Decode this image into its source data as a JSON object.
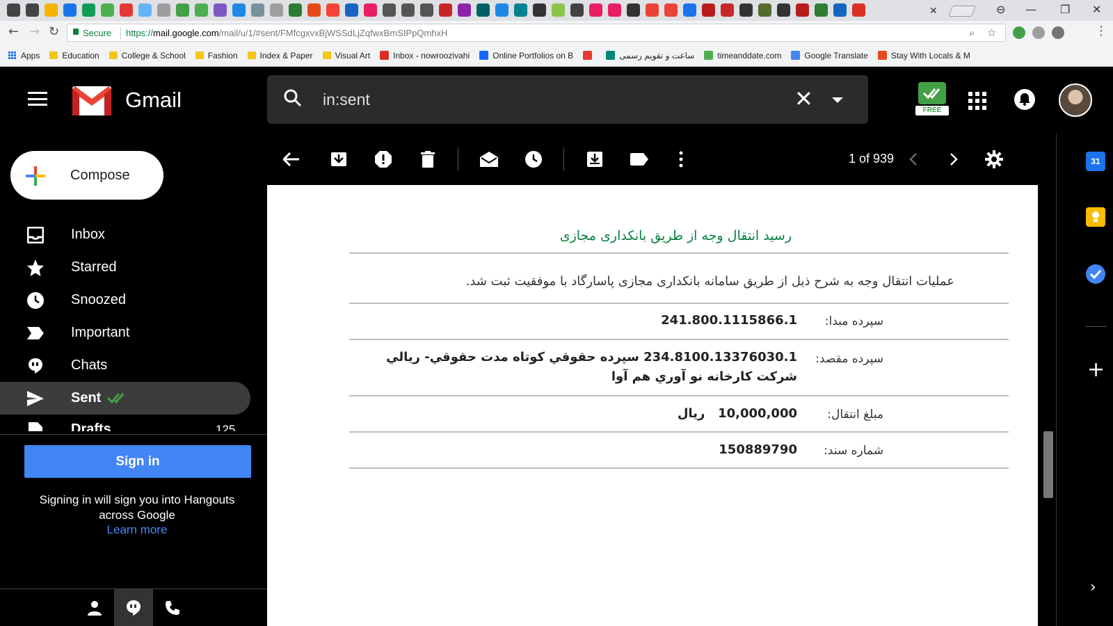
{
  "browser": {
    "tab_icon_colors": [
      "#444",
      "#444",
      "#f4b400",
      "#1a73e8",
      "#0f9d58",
      "#4caf50",
      "#e53935",
      "#64b5f6",
      "#9e9e9e",
      "#43a047",
      "#4caf50",
      "#7e57c2",
      "#1e88e5",
      "#78909c",
      "#9e9e9e",
      "#2e7d32",
      "#e64a19",
      "#f44336",
      "#1565c0",
      "#e91e63",
      "#555",
      "#555",
      "#555",
      "#c62828",
      "#8e24aa",
      "#006064",
      "#1e88e5",
      "#00838f",
      "#333",
      "#8bc34a",
      "#424242",
      "#e91e63",
      "#e91e63",
      "#333",
      "#ea4335",
      "#ea4335",
      "#1a73e8",
      "#b71c1c",
      "#c62828",
      "#333",
      "#556b2f",
      "#333",
      "#b71c1c",
      "#2e7d32",
      "#1565c0",
      "#d93025"
    ],
    "address": {
      "secure_label": "Secure",
      "url_scheme": "https://",
      "url_host": "mail.google.com",
      "url_path": "/mail/u/1/#sent/FMfcgxvxBjWSSdLjZqfwxBmSIPpQmhxH"
    },
    "bookmarks": [
      {
        "label": "Apps",
        "icon": "apps-grid-icon"
      },
      {
        "label": "Education",
        "icon": "folder-icon"
      },
      {
        "label": "College & School",
        "icon": "folder-icon"
      },
      {
        "label": "Fashion",
        "icon": "folder-icon"
      },
      {
        "label": "Index & Paper",
        "icon": "folder-icon"
      },
      {
        "label": "Visual Art",
        "icon": "folder-icon"
      },
      {
        "label": "Inbox - nowroozivahi",
        "icon": "gmail-icon",
        "color": "#d93025"
      },
      {
        "label": "Online Portfolios on B",
        "icon": "behance-icon",
        "color": "#1769ff"
      },
      {
        "label": "",
        "icon": "torob-icon",
        "color": "#e53935"
      },
      {
        "label": "ساعت و تقویم رسمی",
        "icon": "clock-icon",
        "color": "#00897b"
      },
      {
        "label": "timeanddate.com",
        "icon": "timeanddate-icon",
        "color": "#4caf50"
      },
      {
        "label": "Google Translate",
        "icon": "translate-icon",
        "color": "#4285f4"
      },
      {
        "label": "Stay With Locals & M",
        "icon": "couchsurfing-icon",
        "color": "#e64a19"
      }
    ]
  },
  "gmail": {
    "app_name": "Gmail",
    "search_query": "in:sent",
    "free_badge": "FREE",
    "compose_label": "Compose",
    "nav": [
      {
        "label": "Inbox",
        "icon": "inbox-icon",
        "count": "",
        "active": false
      },
      {
        "label": "Starred",
        "icon": "star-icon",
        "count": "",
        "active": false
      },
      {
        "label": "Snoozed",
        "icon": "clock-icon",
        "count": "",
        "active": false
      },
      {
        "label": "Important",
        "icon": "important-icon",
        "count": "",
        "active": false
      },
      {
        "label": "Chats",
        "icon": "chat-icon",
        "count": "",
        "active": false
      },
      {
        "label": "Sent",
        "icon": "send-icon",
        "count": "",
        "active": true
      },
      {
        "label": "Drafts",
        "icon": "draft-icon",
        "count": "125",
        "active": false
      }
    ],
    "hangouts": {
      "signin_label": "Sign in",
      "signin_note": "Signing in will sign you into Hangouts across Google",
      "learn_more": "Learn more"
    },
    "pager": "1 of 939"
  },
  "email": {
    "title": "رسید انتقال وجه از طریق بانکداری مجازی",
    "description": "عملیات انتقال وجه به شرح ذیل از طریق سامانه بانکداری مجازی پاسارگاد با موفقیت ثبت شد.",
    "rows": [
      {
        "label": "سپرده مبدا:",
        "value": "241.800.1115866.1",
        "value2": ""
      },
      {
        "label": "سپرده مقصد:",
        "value": "234.8100.13376030.1 سپرده حقوقي كوتاه مدت حقوقي- ريالي",
        "value2": "شركت كارخانه نو آوري هم آوا"
      },
      {
        "label": "مبلغ انتقال:",
        "value": "10,000,000   ريال",
        "value2": ""
      },
      {
        "label": "شماره سند:",
        "value": "150889790",
        "value2": ""
      }
    ]
  },
  "colors": {
    "accent_blue": "#4285f4",
    "title_green": "#0b8043",
    "calendar_blue": "#1a73e8",
    "keep_yellow": "#fbbc04",
    "tasks_blue": "#4285f4"
  },
  "side_panel": {
    "calendar_day": "31"
  }
}
